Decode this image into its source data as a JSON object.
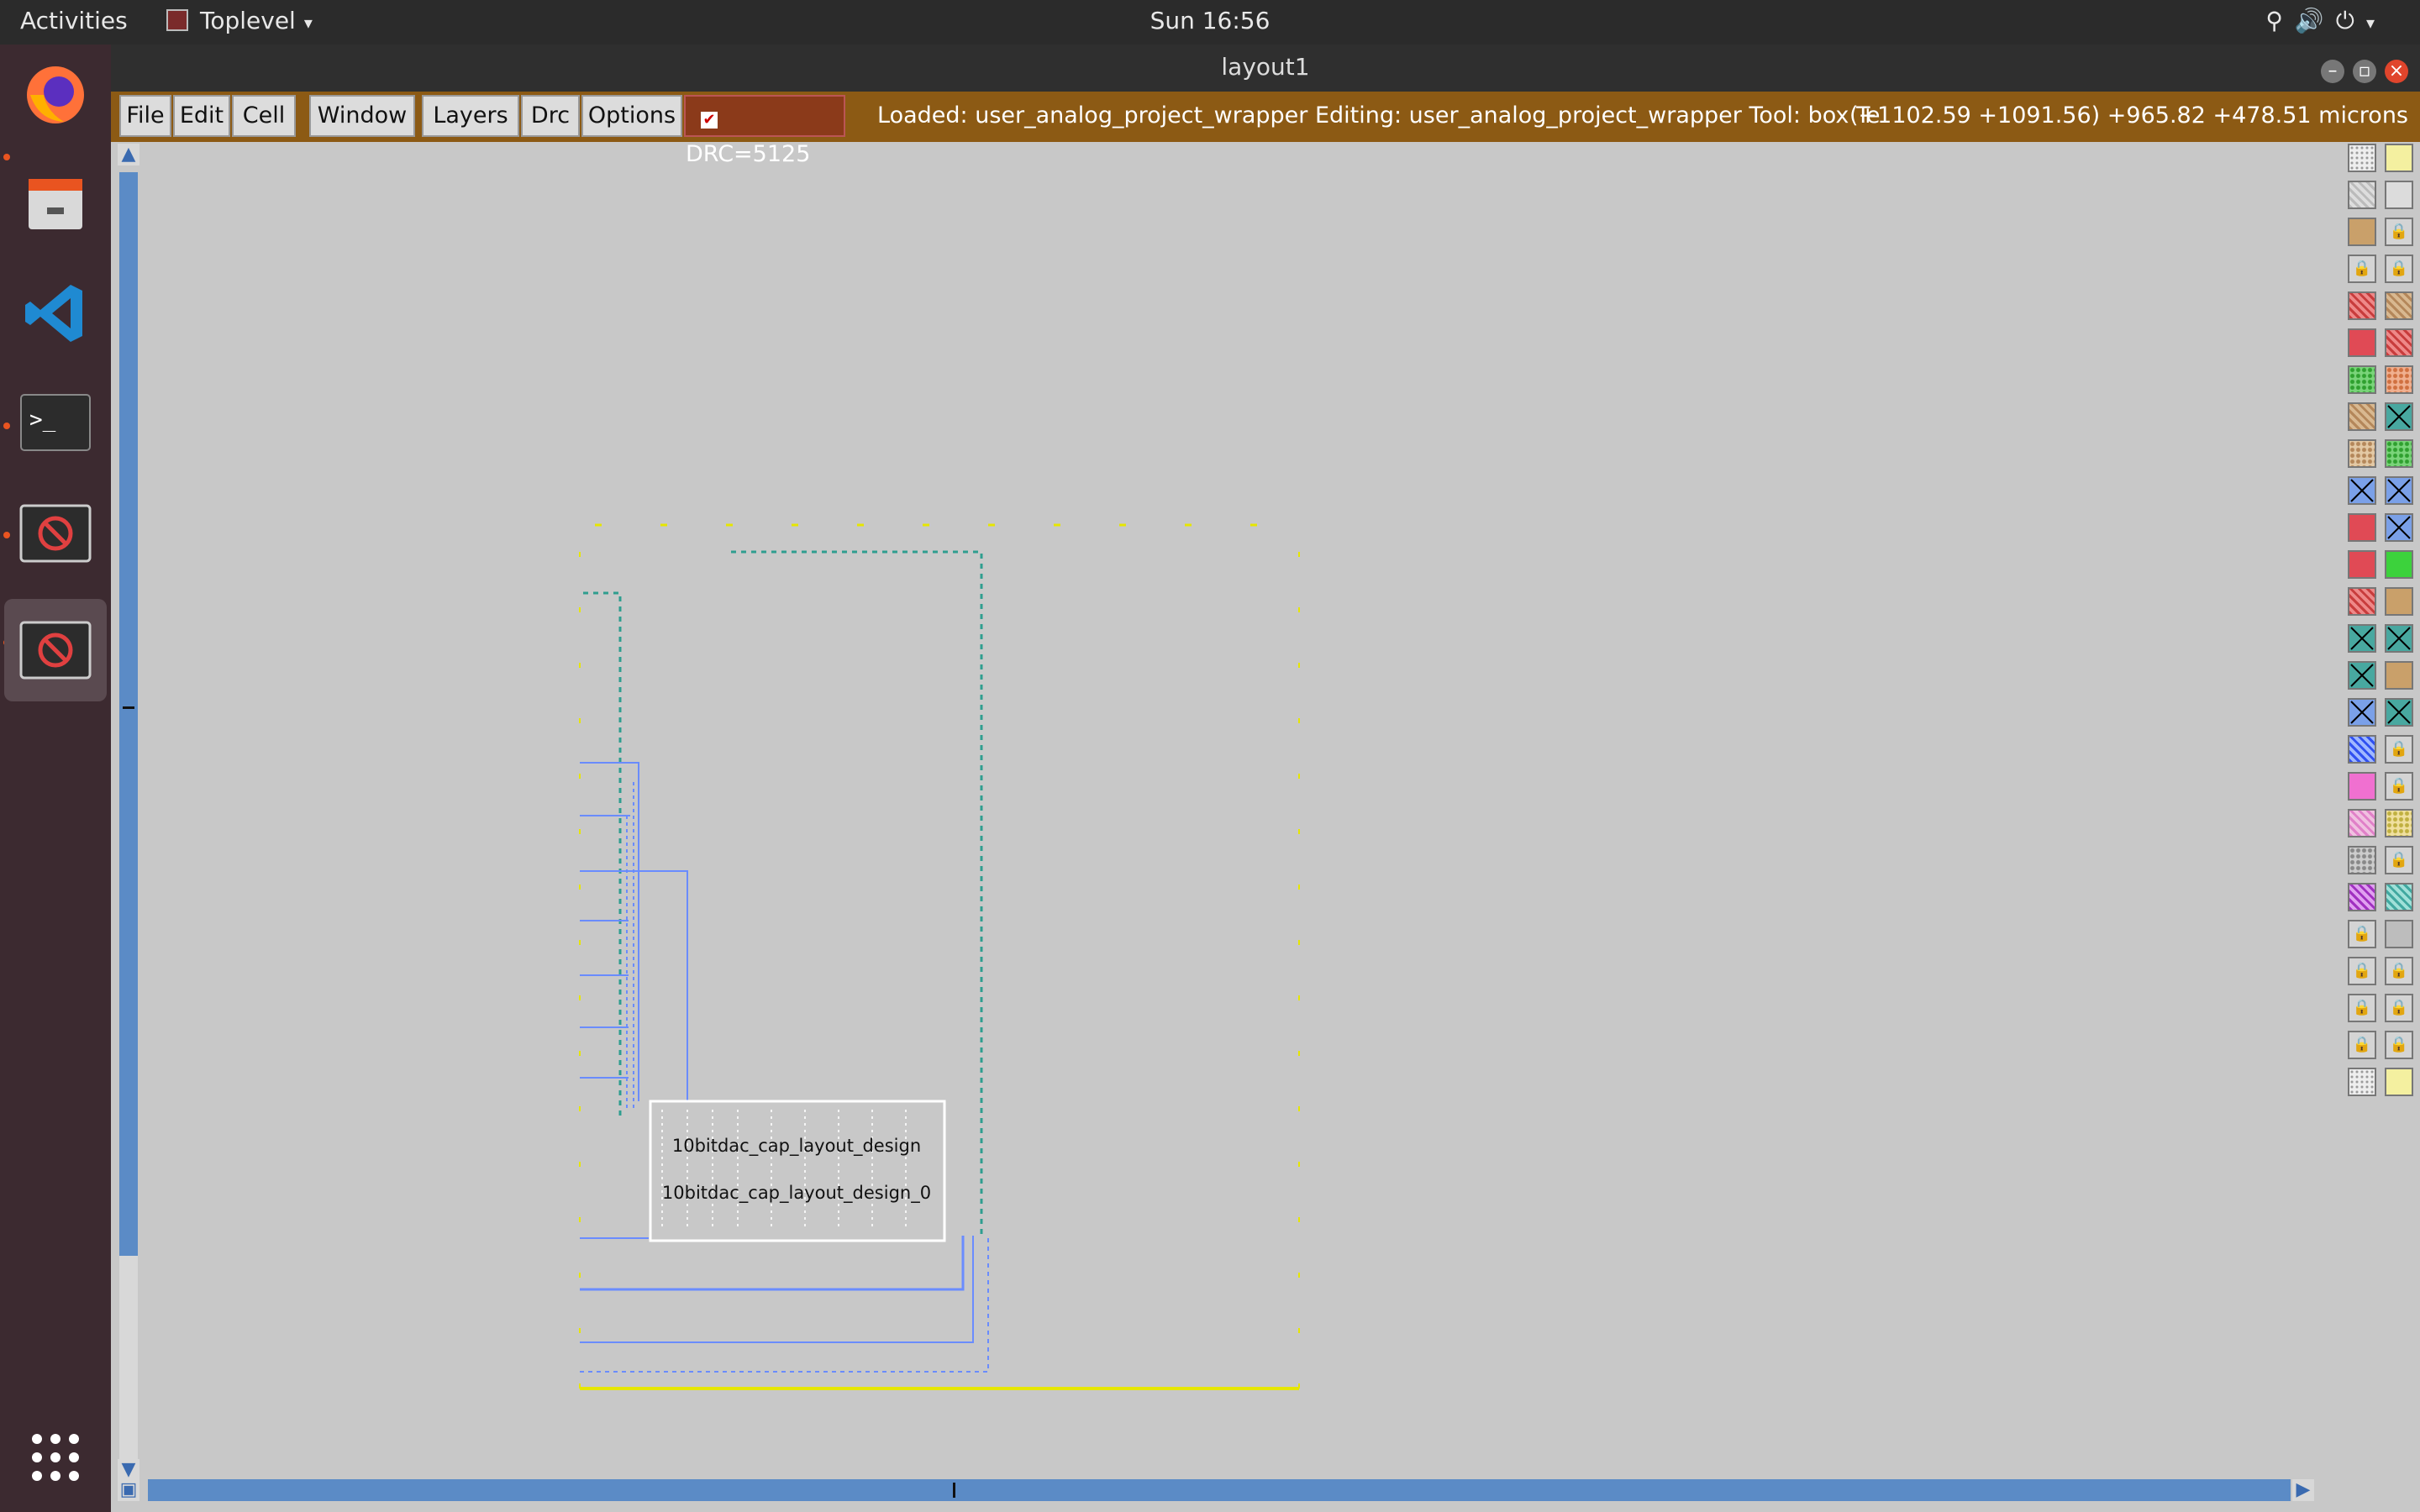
{
  "topbar": {
    "activities": "Activities",
    "app_menu": "Toplevel",
    "clock": "Sun 16:56"
  },
  "dock": {
    "items": [
      {
        "name": "firefox",
        "icon": "firefox-icon",
        "color": "#ff7139"
      },
      {
        "name": "files",
        "icon": "file-cabinet-icon",
        "color": "#d9d9d9"
      },
      {
        "name": "vscode",
        "icon": "vscode-icon",
        "color": "#1f8ad2"
      },
      {
        "name": "terminal",
        "icon": "terminal-icon",
        "color": "#2c2c2c"
      },
      {
        "name": "magic-1",
        "icon": "no-entry-icon",
        "color": "#e04040"
      },
      {
        "name": "magic-2",
        "icon": "no-entry-icon",
        "color": "#e04040"
      }
    ],
    "show_apps_icon": "grid-icon"
  },
  "window": {
    "title": "layout1"
  },
  "menubar": {
    "items": [
      "File",
      "Edit",
      "Cell",
      "Window",
      "Layers",
      "Drc",
      "Options"
    ],
    "drc_label": "DRC=5125",
    "status": "Loaded: user_analog_project_wrapper Editing: user_analog_project_wrapper Tool: box  Te",
    "coords": "(+1102.59 +1091.56) +965.82 +478.51 microns"
  },
  "canvas": {
    "cell_name": "10bitdac_cap_layout_design",
    "instance_name": "10bitdac_cap_layout_design_0"
  },
  "colors": {
    "menubar": "#8c5a14",
    "drc": "#8b3a1a",
    "boundary": "#e6e600",
    "metal_blue": "#6a8cff",
    "metal_green": "#2f9e8f",
    "canvas": "#c8c8c8"
  },
  "palette": {
    "columns": 5,
    "cells": [
      "dots-light",
      "yellow-light",
      "white-box",
      "yellow-diag",
      "black-diag",
      "gray-diag",
      "gray-light",
      "lock",
      "gray-diag",
      "black-diag",
      "tan-solid",
      "lock",
      "lock",
      "lock",
      "red-diag",
      "lock",
      "lock",
      "lock",
      "gray-solid",
      "tan-diag",
      "red-diag",
      "tan-diag",
      "green-dots",
      "green-diag",
      "red-diag",
      "red-solid",
      "red-diag",
      "tan-diag",
      "green-diag",
      "lock",
      "green-dots",
      "orange-dots",
      "green-solid",
      "tan-solid",
      "green-solid",
      "tan-diag",
      "teal-x",
      "blue-x",
      "teal-x",
      "blue-x",
      "tan-dots",
      "green-dots",
      "tan-dots",
      "green-dots",
      "blue-x",
      "blue-x",
      "blue-x",
      "blue-x",
      "lock",
      "lock",
      "red-solid",
      "blue-x",
      "blue-x",
      "red-diag",
      "red-solid",
      "red-solid",
      "green-solid",
      "tan-solid",
      "green-solid",
      "tan-solid",
      "red-diag",
      "tan-solid",
      "green-solid",
      "green-solid",
      "blue-x",
      "teal-x",
      "teal-x",
      "tan-diag",
      "teal-x",
      "blue-x",
      "teal-x",
      "tan-solid",
      "orange-diag",
      "green-solid",
      "blue-x",
      "blue-x",
      "teal-x",
      "blue-wave",
      "lock",
      "blue-wave",
      "blue-pattern",
      "lock",
      "lock",
      "lavender",
      "pink-diag",
      "pink-solid",
      "lock",
      "purple-pattern",
      "lock",
      "pink-dots",
      "pink-diag",
      "yellow-dots",
      "lock",
      "lock",
      "gray-diag",
      "gray-dots",
      "lock",
      "teal-x",
      "lock",
      "pink-diag",
      "purple-diag",
      "teal-diag",
      "teal-diag",
      "lock",
      "purple-dots",
      "lock",
      "gray-solid",
      "black-diag",
      "purple-diag",
      "purple-diag",
      "lock",
      "lock",
      "purple-pattern",
      "pink-diag",
      "lock",
      "lock",
      "lock",
      "black-solid",
      "lock",
      "lock",
      "lock",
      "lock",
      "lock",
      "lock",
      "black-diag",
      "dots-light",
      "yellow-light"
    ]
  }
}
